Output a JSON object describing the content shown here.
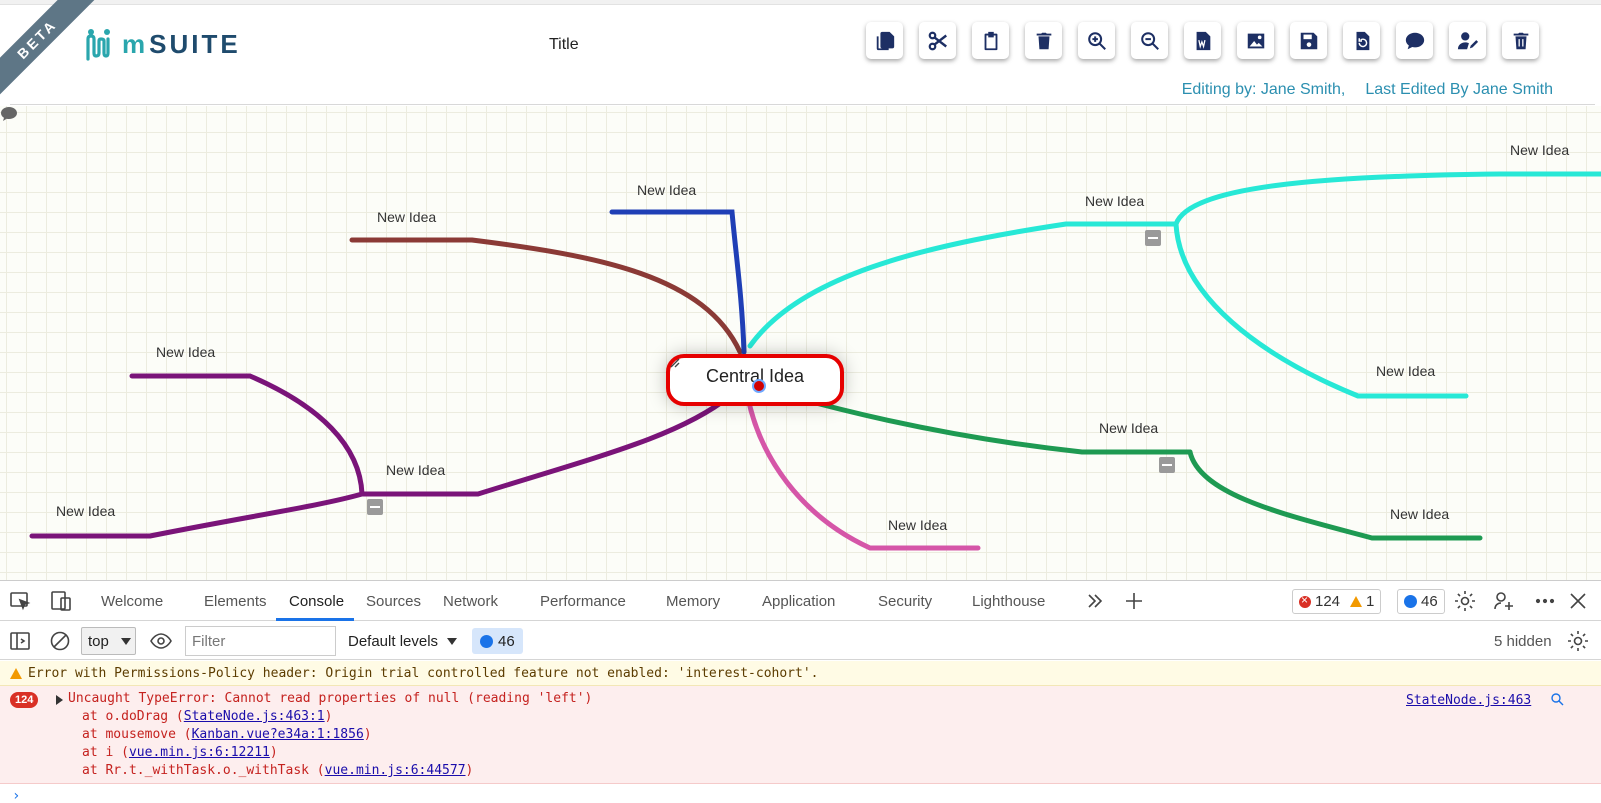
{
  "header": {
    "beta": "BETA",
    "logo_text": "mSUITE",
    "doc_title": "Title",
    "editing_by": "Editing by: Jane Smith,",
    "last_edited": "Last Edited By Jane Smith",
    "toolbar": [
      {
        "icon": "copy-icon"
      },
      {
        "icon": "cut-icon"
      },
      {
        "icon": "paste-icon"
      },
      {
        "icon": "delete-icon"
      },
      {
        "icon": "zoom-in-icon"
      },
      {
        "icon": "zoom-out-icon"
      },
      {
        "icon": "word-export-icon"
      },
      {
        "icon": "image-export-icon"
      },
      {
        "icon": "save-icon"
      },
      {
        "icon": "history-icon"
      },
      {
        "icon": "comment-icon"
      },
      {
        "icon": "user-edit-icon"
      },
      {
        "icon": "trash-icon"
      }
    ]
  },
  "mindmap": {
    "central": "Central Idea",
    "nodes": [
      {
        "label": "New Idea",
        "color": "#8b3a36"
      },
      {
        "label": "New Idea",
        "color": "#1f3fb6"
      },
      {
        "label": "New Idea",
        "color": "#7a1479"
      },
      {
        "label": "New Idea",
        "color": "#7a1479"
      },
      {
        "label": "New Idea",
        "color": "#7a1479"
      },
      {
        "label": "New Idea",
        "color": "#d556a8"
      },
      {
        "label": "New Idea",
        "color": "#27e8d6"
      },
      {
        "label": "New Idea",
        "color": "#27e8d6"
      },
      {
        "label": "New Idea",
        "color": "#27e8d6"
      },
      {
        "label": "New Idea",
        "color": "#1e9a52"
      },
      {
        "label": "New Idea",
        "color": "#1e9a52"
      }
    ]
  },
  "devtools": {
    "tabs": [
      "Welcome",
      "Elements",
      "Console",
      "Sources",
      "Network",
      "Performance",
      "Memory",
      "Application",
      "Security",
      "Lighthouse"
    ],
    "active_tab": "Console",
    "error_count": "124",
    "warning_count": "1",
    "message_count": "46",
    "context": "top",
    "filter_placeholder": "Filter",
    "levels": "Default levels",
    "hidden": "5 hidden",
    "console": {
      "warning": "Error with Permissions-Policy header: Origin trial controlled feature not enabled: 'interest-cohort'.",
      "error_badge": "124",
      "error_message": "Uncaught TypeError: Cannot read properties of null (reading 'left')",
      "error_source": "StateNode.js:463",
      "stack": [
        {
          "prefix": "at o.doDrag (",
          "link": "StateNode.js:463:1",
          "suffix": ")"
        },
        {
          "prefix": "at mousemove (",
          "link": "Kanban.vue?e34a:1:1856",
          "suffix": ")"
        },
        {
          "prefix": "at i (",
          "link": "vue.min.js:6:12211",
          "suffix": ")"
        },
        {
          "prefix": "at Rr.t._withTask.o._withTask (",
          "link": "vue.min.js:6:44577",
          "suffix": ")"
        }
      ],
      "prompt": "›"
    }
  }
}
